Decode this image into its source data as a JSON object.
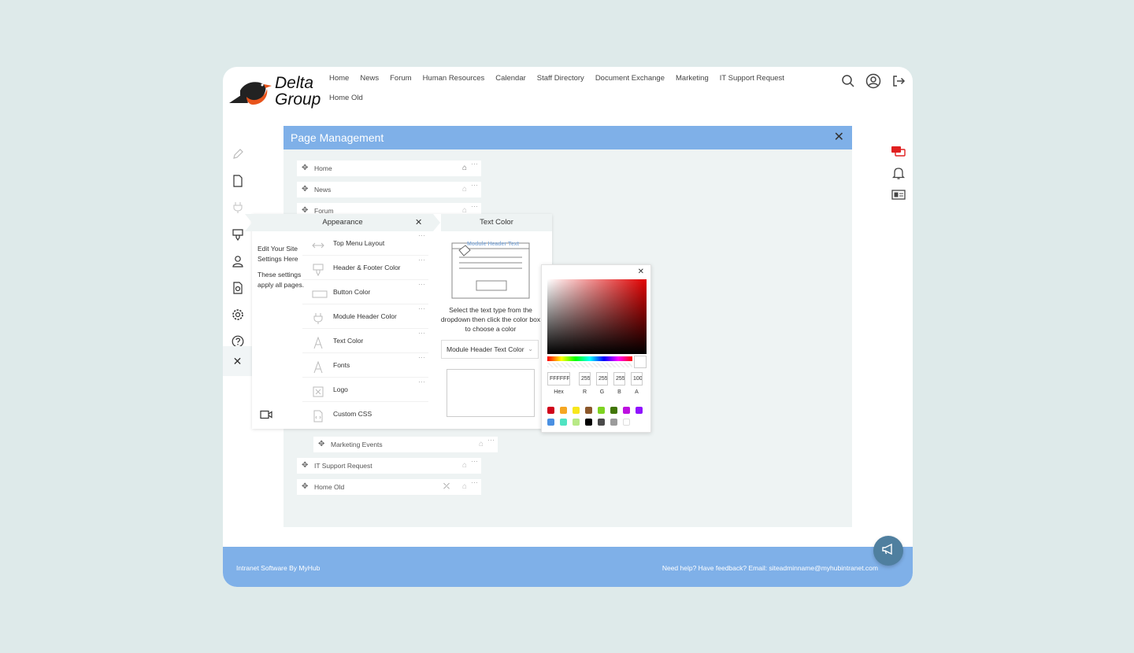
{
  "brand": {
    "line1": "Delta",
    "line2": "Group"
  },
  "topnav": [
    "Home",
    "News",
    "Forum",
    "Human Resources",
    "Calendar",
    "Staff Directory",
    "Document Exchange",
    "Marketing",
    "IT Support Request",
    "Home Old"
  ],
  "top_icons": [
    "search-icon",
    "user-circle-icon",
    "logout-icon"
  ],
  "left_rail": [
    "pencil-icon",
    "page-icon",
    "plug-icon",
    "brush-icon",
    "user-icon",
    "document-settings-icon",
    "gear-icon",
    "help-icon"
  ],
  "right_rail": [
    "chat-icon",
    "bell-icon",
    "id-card-icon"
  ],
  "page_management": {
    "title": "Page Management",
    "pages_top": [
      "Home",
      "News",
      "Forum"
    ],
    "pages_bottom": [
      "Marketing Events",
      "IT Support Request",
      "Home Old"
    ]
  },
  "appearance": {
    "title": "Appearance",
    "desc1": "Edit Your Site Settings Here",
    "desc2": "These settings apply all pages.",
    "items": [
      "Top Menu Layout",
      "Header & Footer Color",
      "Button Color",
      "Module Header Color",
      "Text Color",
      "Fonts",
      "Logo",
      "Custom CSS"
    ]
  },
  "text_color": {
    "title": "Text Color",
    "preview_text": "Module Header Text",
    "instructions": "Select the text type from the dropdown then click the color box to choose a color",
    "selected": "Module Header Text Color"
  },
  "color_picker": {
    "hex": "FFFFFF",
    "r": "255",
    "g": "255",
    "b": "255",
    "a": "100",
    "labels": {
      "hex": "Hex",
      "r": "R",
      "g": "G",
      "b": "B",
      "a": "A"
    },
    "palette": [
      "#d0021b",
      "#f5a623",
      "#f8e71c",
      "#8b572a",
      "#7ed321",
      "#417505",
      "#bd10e0",
      "#9013fe",
      "#4a90e2",
      "#50e3c2",
      "#b8e986",
      "#000000",
      "#4a4a4a",
      "#9b9b9b",
      "#ffffff"
    ]
  },
  "footer": {
    "left": "Intranet Software By MyHub",
    "right": "Need help? Have feedback? Email: siteadminname@myhubintranet.com"
  }
}
